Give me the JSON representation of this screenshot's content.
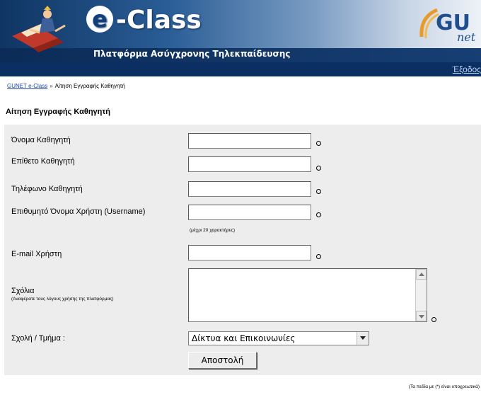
{
  "header": {
    "logo_text": "-Class",
    "logo_letter": "e",
    "platform_title": "Πλατφόρμα Ασύγχρονης Τηλεκπαίδευσης",
    "gunet_logo": "GU",
    "gunet_logo_sub": "net"
  },
  "navbar": {
    "logout_label": "Έξοδος"
  },
  "breadcrumb": {
    "home_link": "GUNET e-Class",
    "separator": "»",
    "current": "Αίτηση Εγγραφής Καθηγητή"
  },
  "page_title": "Αίτηση Εγγραφής Καθηγητή",
  "form": {
    "first_name_label": "Όνομα Καθηγητή",
    "first_name_value": "",
    "last_name_label": "Επίθετο Καθηγητή",
    "last_name_value": "",
    "phone_label": "Τηλέφωνο Καθηγητή",
    "phone_value": "",
    "username_label": "Επιθυμητό Όνομα Χρήστη (Username)",
    "username_value": "",
    "username_hint": "(μέχρι 20 χαρακτήρες)",
    "email_label": "E-mail Χρήστη",
    "email_value": "",
    "comments_label": "Σχόλια",
    "comments_hint": "(Αναφέρατε τους λόγους χρήσης της πλατφόρμας)",
    "comments_value": "",
    "department_label": "Σχολή / Τμήμα :",
    "department_selected": "Δίκτυα και Επικοινωνίες",
    "submit_label": "Αποστολή"
  },
  "footnote": "(Τα πεδία με (*) είναι υποχρεωτικά)",
  "colors": {
    "navbar": "#0b2f63",
    "form_background": "#ededed",
    "link": "#1c46a8"
  }
}
